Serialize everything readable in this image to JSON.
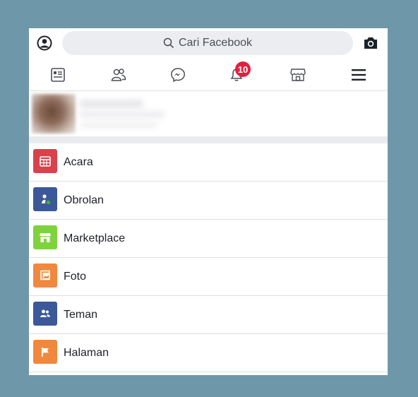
{
  "search": {
    "placeholder": "Cari Facebook"
  },
  "nav": {
    "items": [
      {
        "icon": "news-feed-icon"
      },
      {
        "icon": "friends-icon"
      },
      {
        "icon": "messenger-icon"
      },
      {
        "icon": "bell-icon",
        "badge": "10"
      },
      {
        "icon": "marketplace-icon"
      },
      {
        "icon": "menu-icon"
      }
    ]
  },
  "menu": {
    "items": [
      {
        "label": "Acara",
        "icon": "calendar-icon",
        "color": "#d8424a"
      },
      {
        "label": "Obrolan",
        "icon": "chat-icon",
        "color": "#3b5998"
      },
      {
        "label": "Marketplace",
        "icon": "shop-icon",
        "color": "#7ed33d"
      },
      {
        "label": "Foto",
        "icon": "photo-icon",
        "color": "#f0883e"
      },
      {
        "label": "Teman",
        "icon": "friends-icon",
        "color": "#3b5998"
      },
      {
        "label": "Halaman",
        "icon": "flag-icon",
        "color": "#f0883e"
      }
    ]
  },
  "colors": {
    "background": "#6f97aa",
    "badge": "#e41e3f",
    "search_bg": "#ebedf0"
  }
}
